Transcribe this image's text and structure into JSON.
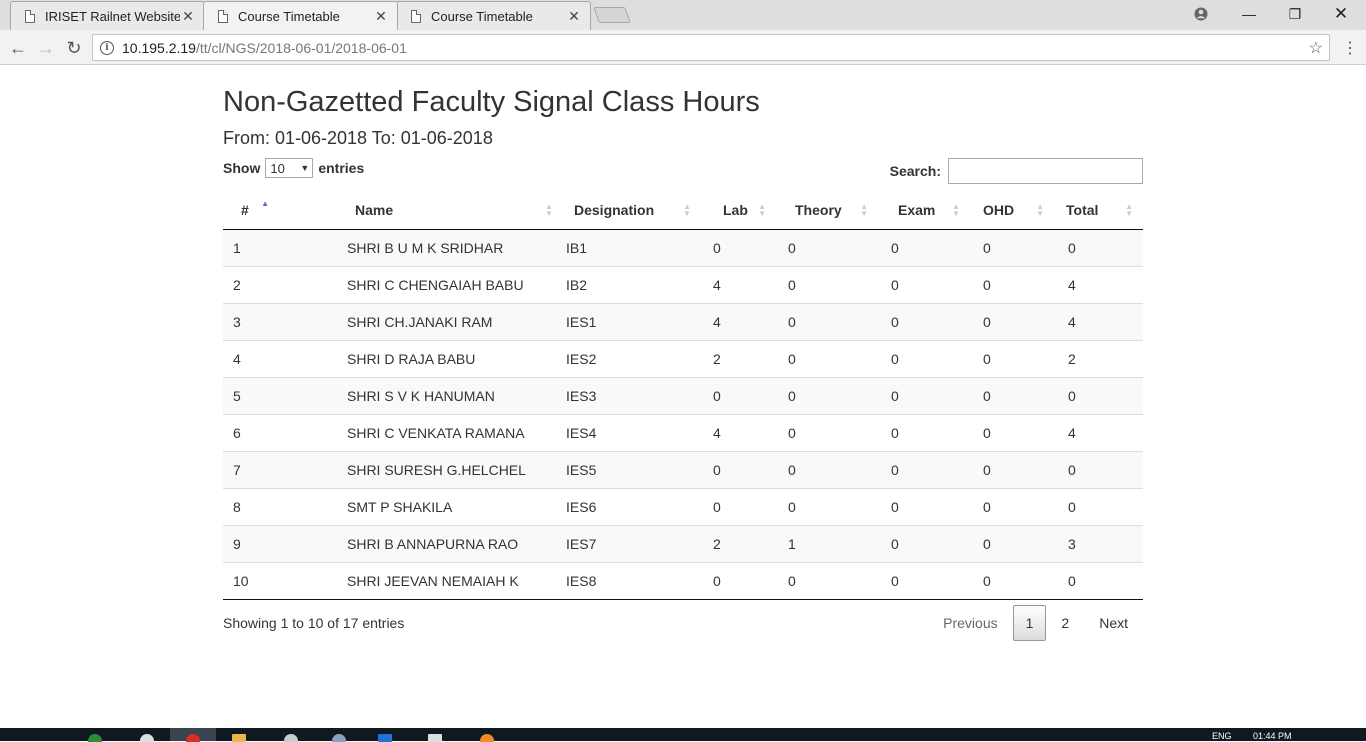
{
  "browser": {
    "tabs": [
      {
        "title": "IRISET Railnet Website",
        "active": false
      },
      {
        "title": "Course Timetable",
        "active": true
      },
      {
        "title": "Course Timetable",
        "active": false
      }
    ],
    "url_host": "10.195.2.19",
    "url_path": "/tt/cl/NGS/2018-06-01/2018-06-01"
  },
  "page": {
    "title": "Non-Gazetted Faculty Signal Class Hours",
    "subtitle": "From: 01-06-2018 To: 01-06-2018"
  },
  "table_controls": {
    "show_label": "Show",
    "entries_label": "entries",
    "page_length": "10",
    "search_label": "Search:",
    "search_value": ""
  },
  "table": {
    "columns": [
      "#",
      "Name",
      "Designation",
      "Lab",
      "Theory",
      "Exam",
      "OHD",
      "Total"
    ],
    "rows": [
      [
        "1",
        "SHRI B U M K SRIDHAR",
        "IB1",
        "0",
        "0",
        "0",
        "0",
        "0"
      ],
      [
        "2",
        "SHRI C CHENGAIAH BABU",
        "IB2",
        "4",
        "0",
        "0",
        "0",
        "4"
      ],
      [
        "3",
        "SHRI CH.JANAKI RAM",
        "IES1",
        "4",
        "0",
        "0",
        "0",
        "4"
      ],
      [
        "4",
        "SHRI D RAJA BABU",
        "IES2",
        "2",
        "0",
        "0",
        "0",
        "2"
      ],
      [
        "5",
        "SHRI S V K HANUMAN",
        "IES3",
        "0",
        "0",
        "0",
        "0",
        "0"
      ],
      [
        "6",
        "SHRI C VENKATA RAMANA",
        "IES4",
        "4",
        "0",
        "0",
        "0",
        "4"
      ],
      [
        "7",
        "SHRI SURESH G.HELCHEL",
        "IES5",
        "0",
        "0",
        "0",
        "0",
        "0"
      ],
      [
        "8",
        "SMT P SHAKILA",
        "IES6",
        "0",
        "0",
        "0",
        "0",
        "0"
      ],
      [
        "9",
        "SHRI B ANNAPURNA RAO",
        "IES7",
        "2",
        "1",
        "0",
        "0",
        "3"
      ],
      [
        "10",
        "SHRI JEEVAN NEMAIAH K",
        "IES8",
        "0",
        "0",
        "0",
        "0",
        "0"
      ]
    ]
  },
  "footer": {
    "info": "Showing 1 to 10 of 17 entries",
    "previous": "Previous",
    "pages": [
      "1",
      "2"
    ],
    "next": "Next"
  },
  "taskbar": {
    "lang": "ENG",
    "time": "01:44 PM"
  }
}
